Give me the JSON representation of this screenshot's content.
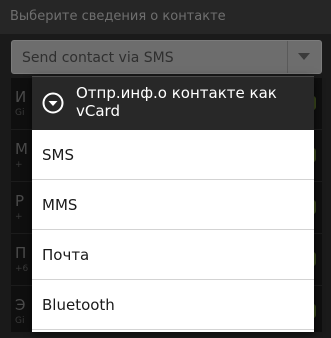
{
  "background_dialog": {
    "title": "Выберите сведения о контакте",
    "spinner_value": "Send contact via SMS",
    "rows": [
      {
        "letter": "И",
        "sub": "Gi"
      },
      {
        "letter": "М",
        "sub": "+"
      },
      {
        "letter": "Р",
        "sub": "+"
      },
      {
        "letter": "П",
        "sub": "+6"
      },
      {
        "letter": "Э",
        "sub": "Gi"
      }
    ]
  },
  "popup": {
    "header_icon": "chevron-down-circle-icon",
    "title": "Отпр.инф.о контакте как vCard",
    "options": [
      {
        "label": "SMS"
      },
      {
        "label": "MMS"
      },
      {
        "label": "Почта"
      },
      {
        "label": "Bluetooth"
      }
    ]
  },
  "colors": {
    "popup_header_bg": "#282828",
    "popup_list_bg": "#ffffff",
    "accent_check": "#3c4a1c"
  }
}
